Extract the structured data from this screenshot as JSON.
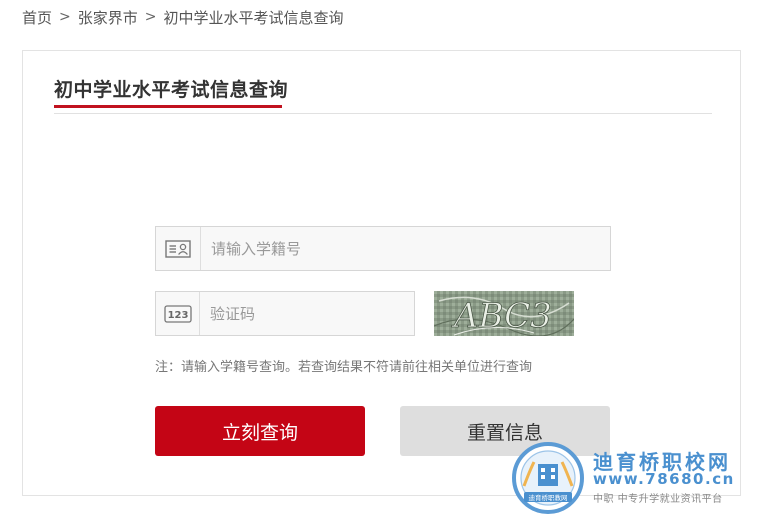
{
  "breadcrumb": {
    "items": [
      "首页",
      "张家界市",
      "初中学业水平考试信息查询"
    ],
    "separator": ">"
  },
  "panel": {
    "title": "初中学业水平考试信息查询",
    "accent_color": "#c1121f"
  },
  "form": {
    "student_id": {
      "placeholder": "请输入学籍号",
      "value": "",
      "icon": "id-card-icon"
    },
    "captcha": {
      "placeholder": "验证码",
      "value": "",
      "icon": "number-123-icon",
      "image_text": "ABC3"
    },
    "note": "注：请输入学籍号查询。若查询结果不符请前往相关单位进行查询",
    "query_button": "立刻查询",
    "reset_button": "重置信息",
    "query_button_color": "#c40515",
    "reset_button_color": "#dedede"
  },
  "watermark": {
    "badge_text": "迪育桥职教网",
    "line1": "迪育桥职校网",
    "line2": "www.78680.cn",
    "line3": "中职 中专升学就业资讯平台",
    "color": "#4a90cf"
  }
}
